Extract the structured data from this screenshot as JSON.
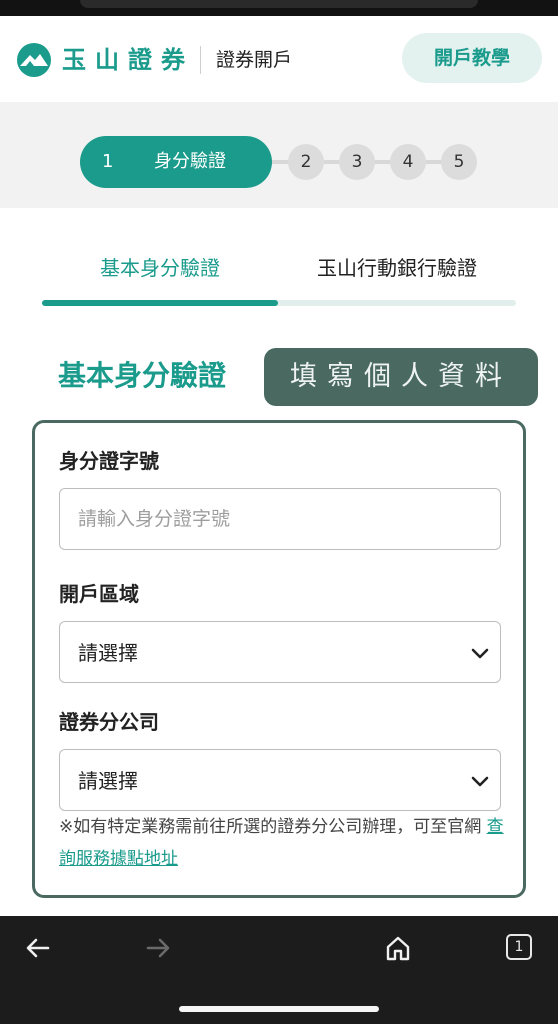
{
  "header": {
    "brand": "玉山證券",
    "subtitle": "證券開戶",
    "tutorial_button": "開戶教學"
  },
  "steps": {
    "active": {
      "number": "1",
      "label": "身分驗證"
    },
    "others": [
      "2",
      "3",
      "4",
      "5"
    ]
  },
  "tabs": {
    "basic": "基本身分驗證",
    "bank": "玉山行動銀行驗證",
    "active_tab": "basic"
  },
  "section": {
    "title": "基本身分驗證",
    "overlay": "填寫個人資料"
  },
  "form": {
    "id_label": "身分證字號",
    "id_placeholder": "請輸入身分證字號",
    "id_value": "",
    "region_label": "開戶區域",
    "region_value": "請選擇",
    "branch_label": "證券分公司",
    "branch_value": "請選擇",
    "note_text": "※如有特定業務需前往所選的證券分公司辦理，可至官網 ",
    "note_link": "查詢服務據點地址"
  },
  "bottom_nav": {
    "tab_count": "1"
  },
  "colors": {
    "accent": "#1a9b8c",
    "overlay_bg": "#4a6961",
    "nav_bg": "#1c1c1c"
  },
  "icons": [
    "esun-logo-icon",
    "chevron-down-icon",
    "back-arrow-icon",
    "forward-arrow-icon",
    "home-icon",
    "tabs-icon"
  ]
}
